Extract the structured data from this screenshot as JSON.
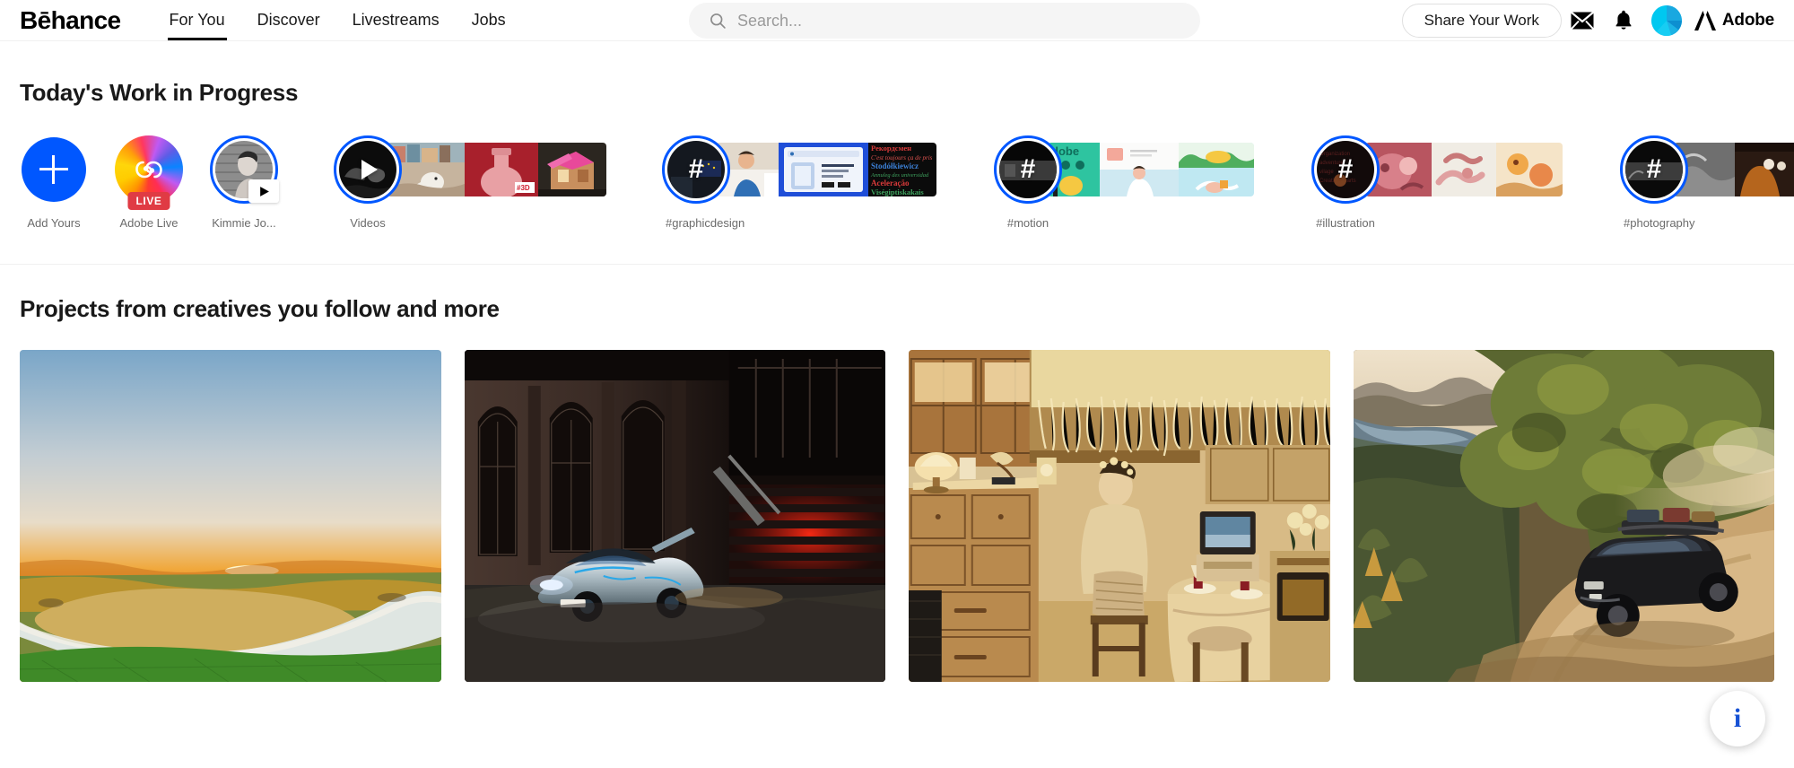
{
  "brand": {
    "logo": "Bēhance",
    "adobe_label": "Adobe",
    "accent": "#0057ff"
  },
  "nav": {
    "items": [
      {
        "label": "For You",
        "active": true
      },
      {
        "label": "Discover",
        "active": false
      },
      {
        "label": "Livestreams",
        "active": false
      },
      {
        "label": "Jobs",
        "active": false
      }
    ]
  },
  "search": {
    "placeholder": "Search...",
    "value": "",
    "icon": "search-icon"
  },
  "header_actions": {
    "share_label": "Share Your Work",
    "mail_icon": "mail-icon",
    "bell_icon": "bell-icon",
    "avatar": "avatar",
    "adobe_icon": "adobe-logo-icon"
  },
  "wip": {
    "title": "Today's Work in Progress",
    "stories": [
      {
        "label": "Add Yours",
        "type": "add"
      },
      {
        "label": "Adobe Live",
        "type": "live",
        "badge": "LIVE"
      },
      {
        "label": "Kimmie Jo...",
        "type": "avatar-video"
      },
      {
        "label": "Videos",
        "type": "video-group"
      },
      {
        "label": "#graphicdesign",
        "type": "hash-group",
        "glyph": "#"
      },
      {
        "label": "#motion",
        "type": "hash-group",
        "glyph": "#"
      },
      {
        "label": "#illustration",
        "type": "hash-group",
        "glyph": "#"
      },
      {
        "label": "#photography",
        "type": "hash-group",
        "glyph": "#"
      }
    ]
  },
  "projects": {
    "title": "Projects from creatives you follow and more",
    "cards": [
      {
        "name": "sunset-river-delta"
      },
      {
        "name": "silver-supercar-night"
      },
      {
        "name": "golden-kitchen-interior"
      },
      {
        "name": "suv-mountain-trail"
      }
    ]
  },
  "fab": {
    "glyph": "i",
    "color": "#1651d4"
  }
}
